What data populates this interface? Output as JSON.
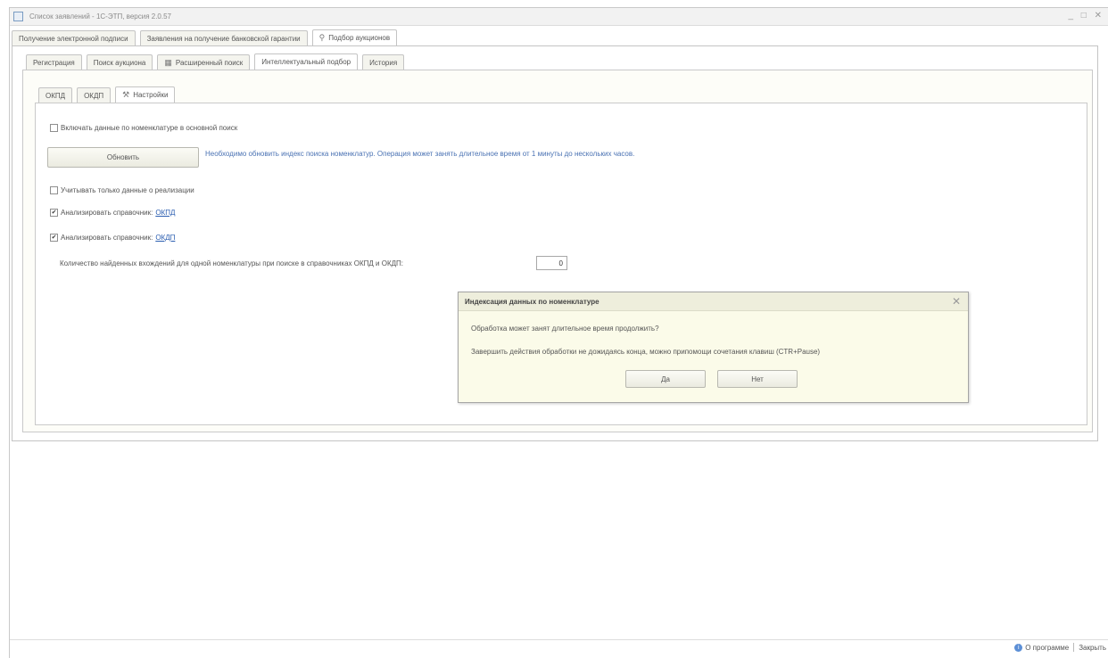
{
  "window": {
    "title": "Список заявлений - 1С-ЭТП, версия 2.0.57",
    "controls": "_ □ ✕"
  },
  "top_tabs": [
    {
      "label": "Получение электронной подписи"
    },
    {
      "label": "Заявления на получение банковской гарантии"
    },
    {
      "label": "Подбор аукционов",
      "icon": "magic-wand-icon"
    }
  ],
  "sub_tabs": [
    {
      "label": "Регистрация"
    },
    {
      "label": "Поиск аукциона"
    },
    {
      "label": "Расширенный поиск",
      "icon": "search-grid-icon"
    },
    {
      "label": "Интеллектуальный подбор"
    },
    {
      "label": "История"
    }
  ],
  "inner_tabs": [
    {
      "label": "ОКПД"
    },
    {
      "label": "ОКДП"
    },
    {
      "label": "Настройки",
      "icon": "tools-icon"
    }
  ],
  "settings": {
    "include_nomenclature": "Включать данные по номенклатуре в основной поиск",
    "update_button": "Обновить",
    "update_note": "Необходимо обновить индекс поиска номенклатур. Операция может занять длительное время от 1 минуты до нескольких часов.",
    "only_sales": "Учитывать только данные о реализации",
    "analyze_okpd_label": "Анализировать справочник:",
    "analyze_okpd_link": "ОКПД",
    "analyze_okdp_label": "Анализировать справочник:",
    "analyze_okdp_link": "ОКДП",
    "count_label": "Количество найденных вхождений для одной номенклатуры при поиске в справочниках ОКПД и ОКДП:",
    "count_value": "0"
  },
  "checkbox_states": {
    "include_nomenclature": false,
    "only_sales": false,
    "analyze_okpd": true,
    "analyze_okdp": true
  },
  "dialog": {
    "title": "Индексация данных по номенклатуре",
    "close": "✕",
    "question": "Обработка может занят длительное время продолжить?",
    "hint": "Завершить действия обработки не дожидаясь конца, можно припомощи сочетания клавиш (CTR+Pause)",
    "yes": "Да",
    "no": "Нет"
  },
  "footer": {
    "about": "О программе",
    "close": "Закрыть"
  },
  "colors": {
    "link": "#2a5db0",
    "note": "#4a72b3",
    "dialog_bg": "#fbfbe9"
  }
}
